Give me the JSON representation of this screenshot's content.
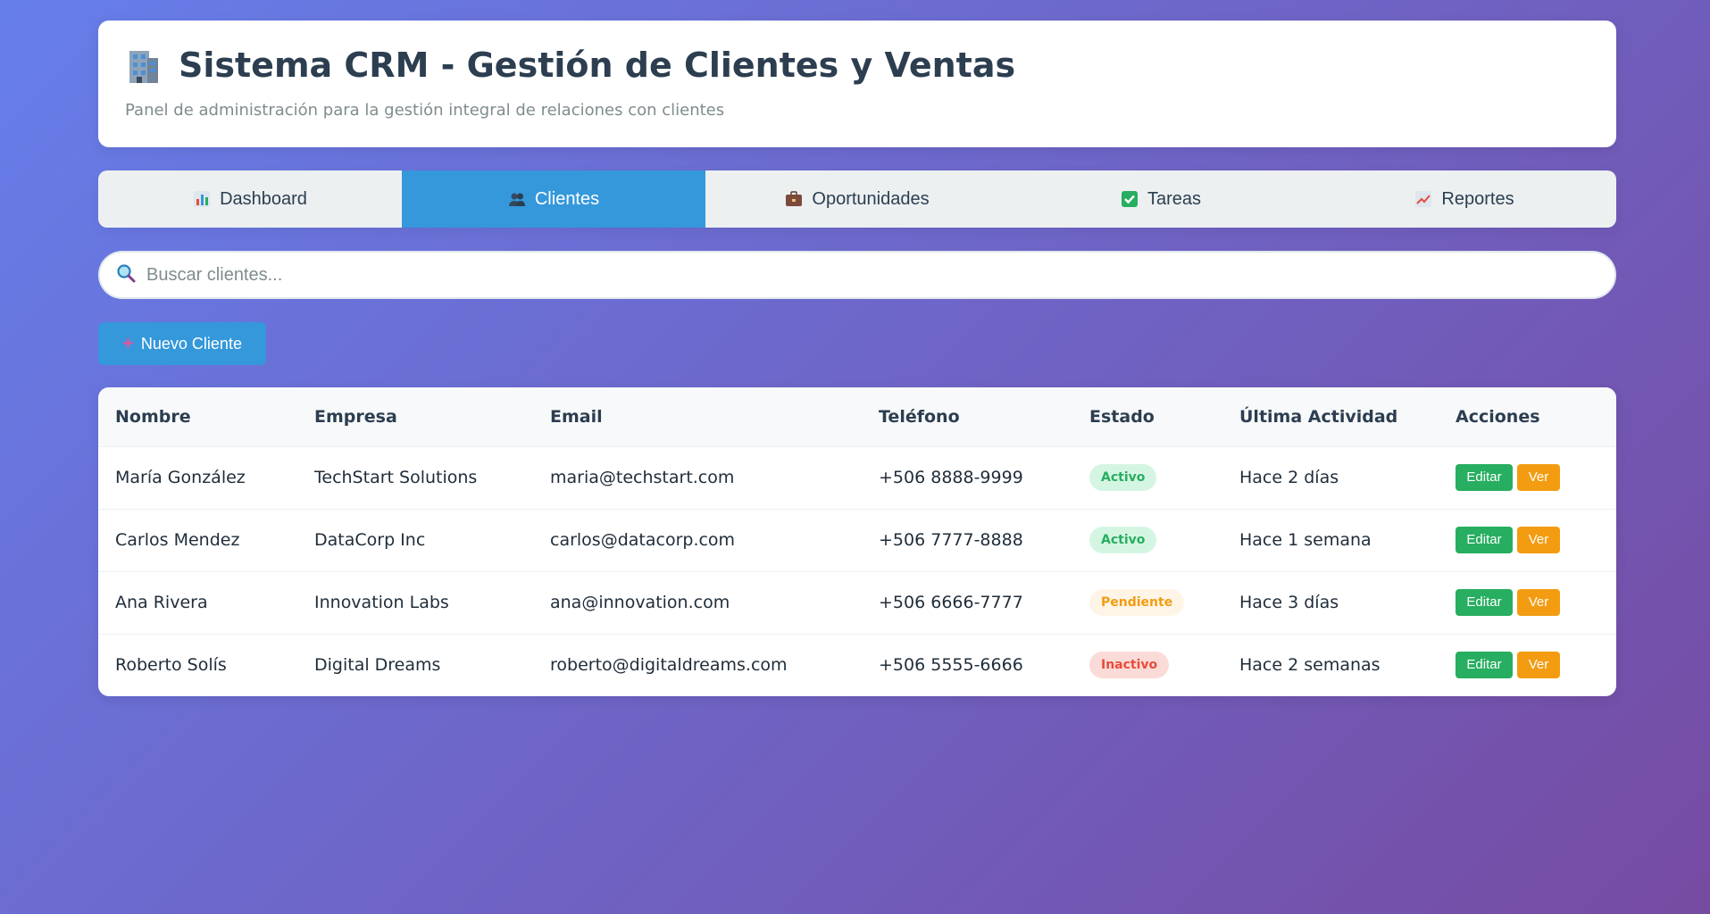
{
  "header": {
    "title": "Sistema CRM - Gestión de Clientes y Ventas",
    "subtitle": "Panel de administración para la gestión integral de relaciones con clientes",
    "icon": "building-icon"
  },
  "tabs": [
    {
      "label": "Dashboard",
      "icon": "bar-chart-icon",
      "active": false
    },
    {
      "label": "Clientes",
      "icon": "users-icon",
      "active": true
    },
    {
      "label": "Oportunidades",
      "icon": "briefcase-icon",
      "active": false
    },
    {
      "label": "Tareas",
      "icon": "checkbox-icon",
      "active": false
    },
    {
      "label": "Reportes",
      "icon": "trend-chart-icon",
      "active": false
    }
  ],
  "search": {
    "placeholder": "Buscar clientes...",
    "value": ""
  },
  "new_button": {
    "label": "Nuevo Cliente"
  },
  "table": {
    "columns": [
      "Nombre",
      "Empresa",
      "Email",
      "Teléfono",
      "Estado",
      "Última Actividad",
      "Acciones"
    ],
    "rows": [
      {
        "nombre": "María González",
        "empresa": "TechStart Solutions",
        "email": "maria@techstart.com",
        "telefono": "+506 8888-9999",
        "estado": "Activo",
        "actividad": "Hace 2 días"
      },
      {
        "nombre": "Carlos Mendez",
        "empresa": "DataCorp Inc",
        "email": "carlos@datacorp.com",
        "telefono": "+506 7777-8888",
        "estado": "Activo",
        "actividad": "Hace 1 semana"
      },
      {
        "nombre": "Ana Rivera",
        "empresa": "Innovation Labs",
        "email": "ana@innovation.com",
        "telefono": "+506 6666-7777",
        "estado": "Pendiente",
        "actividad": "Hace 3 días"
      },
      {
        "nombre": "Roberto Solís",
        "empresa": "Digital Dreams",
        "email": "roberto@digitaldreams.com",
        "telefono": "+506 5555-6666",
        "estado": "Inactivo",
        "actividad": "Hace 2 semanas"
      }
    ],
    "actions": {
      "edit": "Editar",
      "view": "Ver"
    }
  },
  "colors": {
    "accent": "#3498db",
    "success": "#27ae60",
    "warning": "#f39c12",
    "danger": "#e74c3c",
    "bg_gradient_start": "#667eea",
    "bg_gradient_end": "#764ba2"
  }
}
